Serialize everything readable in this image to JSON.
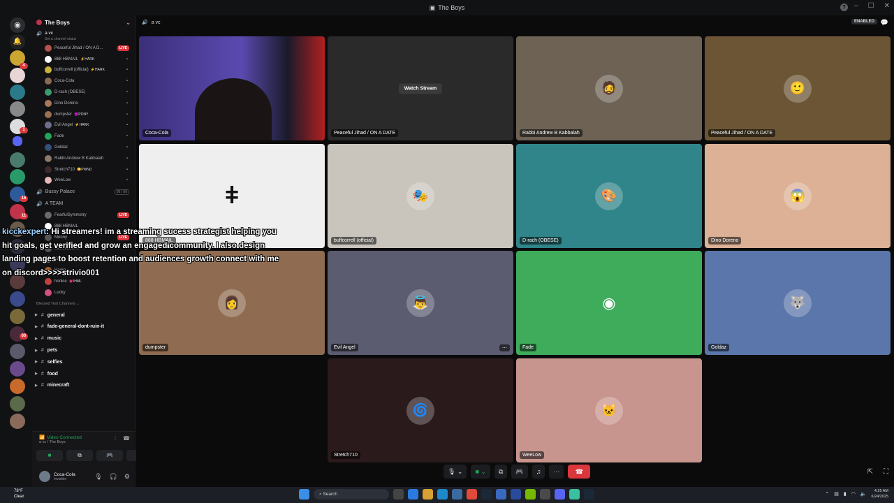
{
  "window": {
    "title": "The Boys"
  },
  "guild": {
    "name": "The Boys"
  },
  "voice_channel": {
    "name": "a vc",
    "status_placeholder": "Set a channel status"
  },
  "members": [
    {
      "name": "Peaceful Jihad / ON A D...",
      "tag": "",
      "live": true,
      "color": "#b5524a"
    },
    {
      "name": "888 HBMAIL",
      "tag": "⚡HARK",
      "live": false,
      "color": "#ffffff"
    },
    {
      "name": "buffcorrell (official)",
      "tag": "⚡HARK",
      "live": false,
      "color": "#c9b23a"
    },
    {
      "name": "Coca-Cola",
      "tag": "",
      "live": false,
      "color": "#8a6a55"
    },
    {
      "name": "D-rach (OBESE)",
      "tag": "",
      "live": false,
      "color": "#3b9a6c"
    },
    {
      "name": "Dino Doreno",
      "tag": "",
      "live": false,
      "color": "#a8785c"
    },
    {
      "name": "dumpster",
      "tag": "😈PONY",
      "live": false,
      "color": "#9a6f55"
    },
    {
      "name": "Evil Angel",
      "tag": "⚡HARK",
      "live": false,
      "color": "#6d6f8a"
    },
    {
      "name": "Fade",
      "tag": "",
      "live": false,
      "color": "#23a55a"
    },
    {
      "name": "Goldaz",
      "tag": "",
      "live": false,
      "color": "#34507a"
    },
    {
      "name": "Rabbi Andrew B Kabbalah",
      "tag": "",
      "live": false,
      "color": "#8a7a6a"
    },
    {
      "name": "Stretch710",
      "tag": "😜PWND",
      "live": false,
      "color": "#3a2a2a"
    },
    {
      "name": "WeeLow",
      "tag": "",
      "live": false,
      "color": "#e8b7b7"
    }
  ],
  "other_channels": [
    {
      "name": "Bussy Palace",
      "count": "00 / 99"
    },
    {
      "name": "A TEAM"
    }
  ],
  "team_members": [
    {
      "name": "FearfulSymmetry",
      "live": true,
      "color": "#6a6a6a"
    },
    {
      "name": "888 HBMAIL",
      "color": "#ffffff"
    },
    {
      "name": "Moony",
      "live": true,
      "color": "#555"
    },
    {
      "name": "beelzebub.vv",
      "color": "#555"
    },
    {
      "name": "Eris",
      "color": "#8a8a8a"
    },
    {
      "name": "Hagro",
      "color": "#a06030"
    },
    {
      "name": "honkie",
      "tag": "💗IHML",
      "color": "#c04040"
    },
    {
      "name": "Lucky",
      "color": "#d05080"
    }
  ],
  "text_category": "Blessed Text Channels",
  "text_channels": [
    "general",
    "fade-general-dont-ruin-it",
    "music",
    "pets",
    "selfies",
    "food",
    "minecraft"
  ],
  "voice_panel": {
    "status": "Video Connected",
    "location": "a vc / The Boys"
  },
  "user": {
    "name": "Coca-Cola",
    "status": "Invisible"
  },
  "header": {
    "channel": "a vc",
    "enabled_label": "ENABLED"
  },
  "tiles": [
    {
      "name": "Coca-Cola",
      "bg": "#4a3a8a",
      "avatar": "",
      "kind": "video"
    },
    {
      "name": "Peaceful Jihad / ON A DATE",
      "bg": "#2a2a2a",
      "avatar": "",
      "kind": "stream",
      "watch_label": "Watch Stream"
    },
    {
      "name": "Rabbi Andrew B Kabbalah",
      "bg": "#6e6255",
      "avatar": "🧔",
      "kind": "avatar"
    },
    {
      "name": "Peaceful Jihad / ON A DATE",
      "bg": "#6b5534",
      "avatar": "🙂",
      "kind": "avatar"
    },
    {
      "name": "888 HBMAIL",
      "bg": "#efefef",
      "avatar": "ǂ",
      "kind": "symbol"
    },
    {
      "name": "buffcorrell (official)",
      "bg": "#c9c5bd",
      "avatar": "🎭",
      "kind": "avatar"
    },
    {
      "name": "D-rach (OBESE)",
      "bg": "#2f8589",
      "avatar": "🎨",
      "kind": "avatar"
    },
    {
      "name": "Dino Doreno",
      "bg": "#dcb196",
      "avatar": "😱",
      "kind": "avatar"
    },
    {
      "name": "dumpster",
      "bg": "#8f6c51",
      "avatar": "👩",
      "kind": "avatar"
    },
    {
      "name": "Evil Angel",
      "bg": "#5b5c70",
      "avatar": "👼",
      "kind": "avatar"
    },
    {
      "name": "Fade",
      "bg": "#3fac5c",
      "avatar": "🎮",
      "kind": "discord"
    },
    {
      "name": "Goldaz",
      "bg": "#5b76aa",
      "avatar": "🐺",
      "kind": "avatar"
    },
    {
      "name": "Stretch710",
      "bg": "#2a1a1c",
      "avatar": "🌀",
      "kind": "avatar"
    },
    {
      "name": "WeeLow",
      "bg": "#c8958e",
      "avatar": "🐱",
      "kind": "avatar"
    }
  ],
  "overlay": {
    "author": "kicckexpert",
    "message": ": Hi streamers! im a streaming sucess strategist helping you hit goals, get verified and grow an engaged community. I also design landing pages to boost retention and audiences growth connect with me on discord>>>>strivio001"
  },
  "taskbar": {
    "weather_temp": "78°F",
    "weather_cond": "Clear",
    "search_placeholder": "Search",
    "time": "4:25 AM",
    "date": "6/24/2025"
  },
  "colors": {
    "accent": "#5865f2",
    "danger": "#da373c",
    "online": "#23a55a"
  }
}
